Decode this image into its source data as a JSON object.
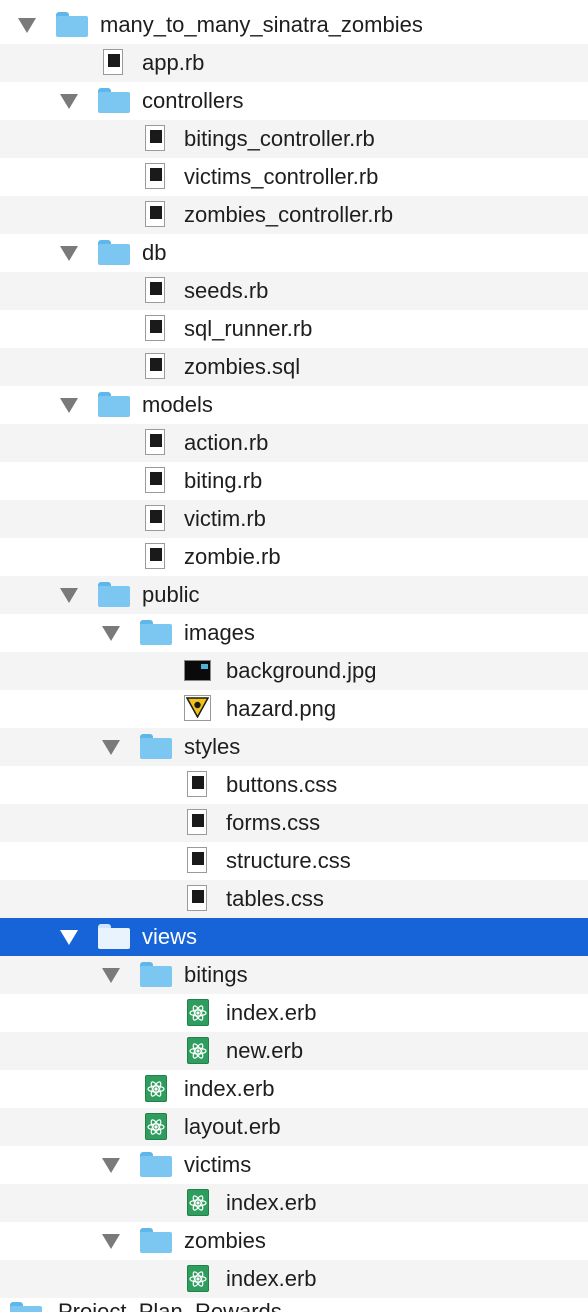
{
  "colors": {
    "selection": "#1764d8",
    "folder": "#7cc7f2",
    "erb": "#2f9d5e"
  },
  "tree": [
    {
      "label": "many_to_many_sinatra_zombies",
      "kind": "folder",
      "depth": 0,
      "expanded": true,
      "icon": "folder-icon"
    },
    {
      "label": "app.rb",
      "kind": "ruby",
      "depth": 1,
      "icon": "ruby-file-icon",
      "tag": "RUBY"
    },
    {
      "label": "controllers",
      "kind": "folder",
      "depth": 1,
      "expanded": true,
      "icon": "folder-icon"
    },
    {
      "label": "bitings_controller.rb",
      "kind": "ruby",
      "depth": 2,
      "icon": "ruby-file-icon",
      "tag": "RUBY"
    },
    {
      "label": "victims_controller.rb",
      "kind": "ruby",
      "depth": 2,
      "icon": "ruby-file-icon",
      "tag": "RUBY"
    },
    {
      "label": "zombies_controller.rb",
      "kind": "ruby",
      "depth": 2,
      "icon": "ruby-file-icon",
      "tag": "RUBY"
    },
    {
      "label": "db",
      "kind": "folder",
      "depth": 1,
      "expanded": true,
      "icon": "folder-icon"
    },
    {
      "label": "seeds.rb",
      "kind": "ruby",
      "depth": 2,
      "icon": "ruby-file-icon",
      "tag": "RUBY"
    },
    {
      "label": "sql_runner.rb",
      "kind": "ruby",
      "depth": 2,
      "icon": "ruby-file-icon",
      "tag": "RUBY"
    },
    {
      "label": "zombies.sql",
      "kind": "sql",
      "depth": 2,
      "icon": "sql-file-icon",
      "tag": "SQL"
    },
    {
      "label": "models",
      "kind": "folder",
      "depth": 1,
      "expanded": true,
      "icon": "folder-icon"
    },
    {
      "label": "action.rb",
      "kind": "ruby",
      "depth": 2,
      "icon": "ruby-file-icon",
      "tag": "RUBY"
    },
    {
      "label": "biting.rb",
      "kind": "ruby",
      "depth": 2,
      "icon": "ruby-file-icon",
      "tag": "RUBY"
    },
    {
      "label": "victim.rb",
      "kind": "ruby",
      "depth": 2,
      "icon": "ruby-file-icon",
      "tag": "RUBY"
    },
    {
      "label": "zombie.rb",
      "kind": "ruby",
      "depth": 2,
      "icon": "ruby-file-icon",
      "tag": "RUBY"
    },
    {
      "label": "public",
      "kind": "folder",
      "depth": 1,
      "expanded": true,
      "icon": "folder-icon"
    },
    {
      "label": "images",
      "kind": "folder",
      "depth": 2,
      "expanded": true,
      "icon": "folder-icon"
    },
    {
      "label": "background.jpg",
      "kind": "jpg",
      "depth": 3,
      "icon": "image-file-icon"
    },
    {
      "label": "hazard.png",
      "kind": "png",
      "depth": 3,
      "icon": "hazard-image-icon"
    },
    {
      "label": "styles",
      "kind": "folder",
      "depth": 2,
      "expanded": true,
      "icon": "folder-icon"
    },
    {
      "label": "buttons.css",
      "kind": "css",
      "depth": 3,
      "icon": "css-file-icon",
      "tag": "CSS"
    },
    {
      "label": "forms.css",
      "kind": "css",
      "depth": 3,
      "icon": "css-file-icon",
      "tag": "CSS"
    },
    {
      "label": "structure.css",
      "kind": "css",
      "depth": 3,
      "icon": "css-file-icon",
      "tag": "CSS"
    },
    {
      "label": "tables.css",
      "kind": "css",
      "depth": 3,
      "icon": "css-file-icon",
      "tag": "CSS"
    },
    {
      "label": "views",
      "kind": "folder",
      "depth": 1,
      "expanded": true,
      "selected": true,
      "icon": "folder-icon"
    },
    {
      "label": "bitings",
      "kind": "folder",
      "depth": 2,
      "expanded": true,
      "icon": "folder-icon"
    },
    {
      "label": "index.erb",
      "kind": "erb",
      "depth": 3,
      "icon": "erb-file-icon"
    },
    {
      "label": "new.erb",
      "kind": "erb",
      "depth": 3,
      "icon": "erb-file-icon"
    },
    {
      "label": "index.erb",
      "kind": "erb",
      "depth": 2,
      "icon": "erb-file-icon"
    },
    {
      "label": "layout.erb",
      "kind": "erb",
      "depth": 2,
      "icon": "erb-file-icon"
    },
    {
      "label": "victims",
      "kind": "folder",
      "depth": 2,
      "expanded": true,
      "icon": "folder-icon"
    },
    {
      "label": "index.erb",
      "kind": "erb",
      "depth": 3,
      "icon": "erb-file-icon"
    },
    {
      "label": "zombies",
      "kind": "folder",
      "depth": 2,
      "expanded": true,
      "icon": "folder-icon"
    },
    {
      "label": "index.erb",
      "kind": "erb",
      "depth": 3,
      "icon": "erb-file-icon"
    }
  ],
  "next_item": {
    "label": "Project_Plan_Rewards",
    "icon": "folder-icon"
  }
}
